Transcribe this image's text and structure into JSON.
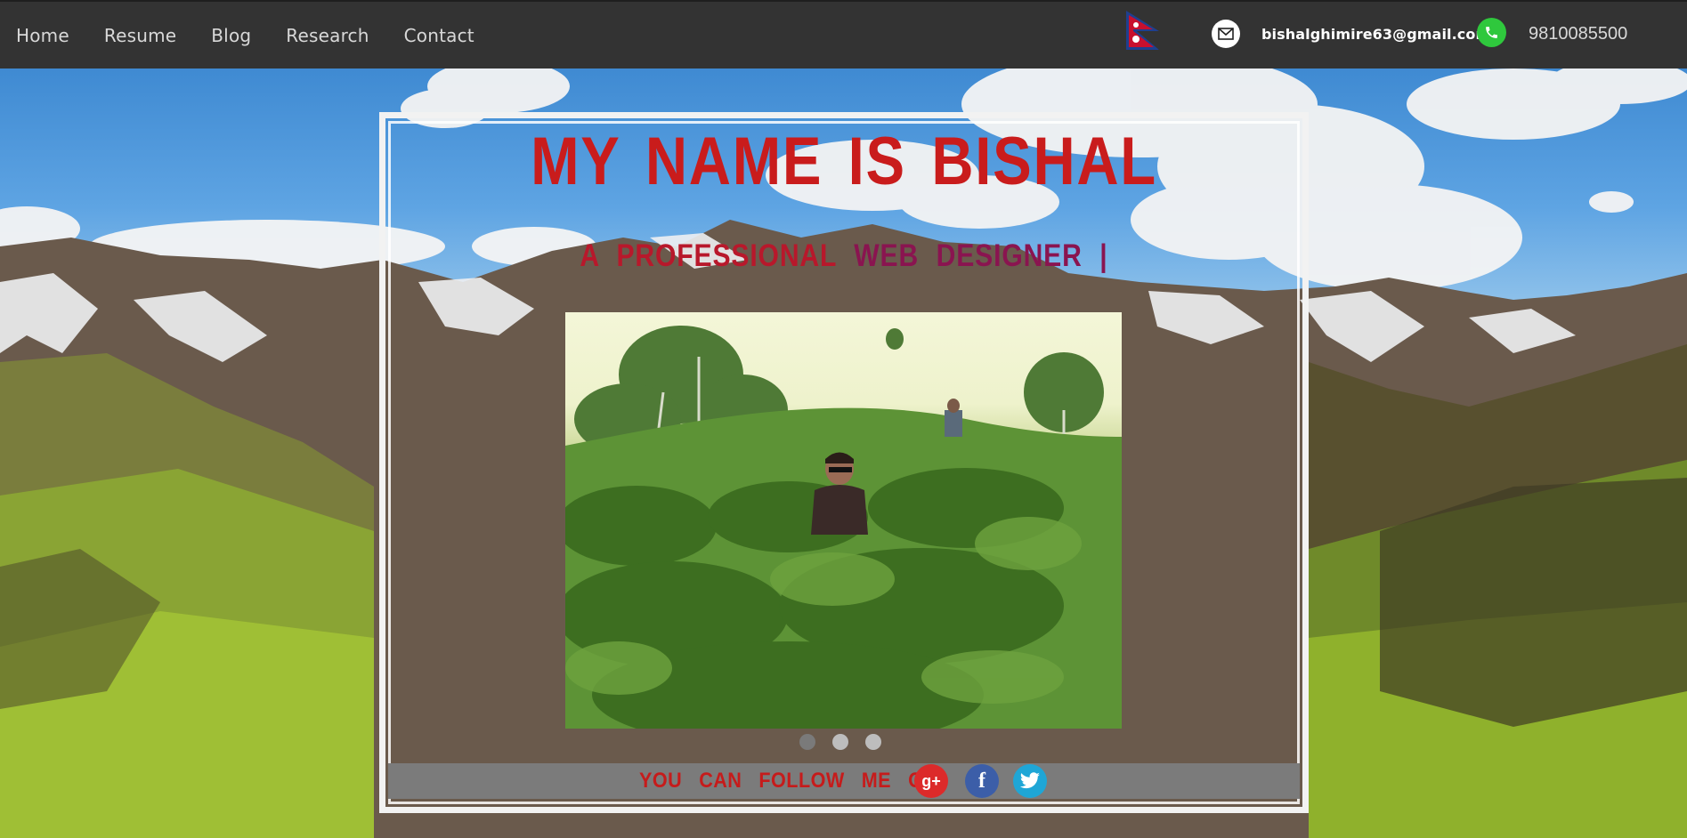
{
  "nav": {
    "items": [
      {
        "label": "Home"
      },
      {
        "label": "Resume"
      },
      {
        "label": "Blog"
      },
      {
        "label": "Research"
      },
      {
        "label": "Contact"
      }
    ]
  },
  "contact": {
    "email": "bishalghimire63@gmail.com",
    "phone": "9810085500",
    "icons": [
      "nepal-flag-icon",
      "mail-icon",
      "phone-icon"
    ]
  },
  "hero": {
    "title": "MY NAME IS BISHAL",
    "subtitle_part1": "A PROFESSIONAL",
    "subtitle_part2": "WEB DESIGNER |"
  },
  "carousel": {
    "slide_count": 3,
    "active_index": 0
  },
  "follow": {
    "label": "YOU CAN FOLLOW ME ON:",
    "networks": [
      {
        "icon": "google-plus-icon",
        "glyph": "g+"
      },
      {
        "icon": "facebook-icon",
        "glyph": "f"
      },
      {
        "icon": "twitter-icon"
      }
    ]
  },
  "colors": {
    "topbar": "#333333",
    "title_red": "#c91c1c",
    "subtitle_plum": "#8a1450",
    "follow_bar": "#7b7b7b",
    "gplus": "#dc2a2a",
    "facebook": "#3c5ea8",
    "twitter": "#1fa6d6",
    "phone_green": "#2fc83d"
  }
}
